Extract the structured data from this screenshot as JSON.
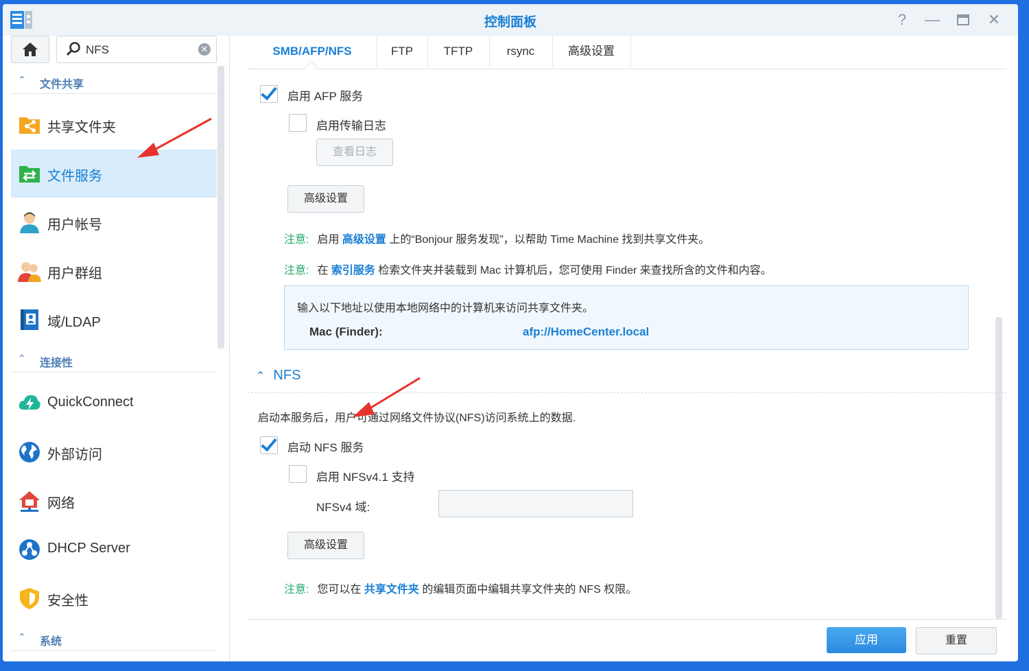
{
  "window": {
    "title": "控制面板"
  },
  "sidebar": {
    "search_value": "NFS",
    "sections": [
      {
        "label": "文件共享"
      },
      {
        "label": "连接性"
      },
      {
        "label": "系统"
      }
    ],
    "items": [
      {
        "label": "共享文件夹",
        "icon": "shared-folder-icon"
      },
      {
        "label": "文件服务",
        "icon": "file-services-icon"
      },
      {
        "label": "用户帐号",
        "icon": "user-icon"
      },
      {
        "label": "用户群组",
        "icon": "user-group-icon"
      },
      {
        "label": "域/LDAP",
        "icon": "ldap-icon"
      },
      {
        "label": "QuickConnect",
        "icon": "quickconnect-icon"
      },
      {
        "label": "外部访问",
        "icon": "globe-icon"
      },
      {
        "label": "网络",
        "icon": "network-icon"
      },
      {
        "label": "DHCP Server",
        "icon": "dhcp-icon"
      },
      {
        "label": "安全性",
        "icon": "shield-icon"
      }
    ]
  },
  "tabs": [
    {
      "label": "SMB/AFP/NFS"
    },
    {
      "label": "FTP"
    },
    {
      "label": "TFTP"
    },
    {
      "label": "rsync"
    },
    {
      "label": "高级设置"
    }
  ],
  "afp": {
    "enable_label": "启用 AFP 服务",
    "enable_checked": true,
    "log_label": "启用传输日志",
    "log_checked": false,
    "view_log_button": "查看日志",
    "advanced_button": "高级设置",
    "note1": {
      "prefix": "注意:",
      "text1": "启用",
      "link": "高级设置",
      "text2": "上的“Bonjour 服务发现”，以帮助 Time Machine 找到共享文件夹。"
    },
    "note2": {
      "prefix": "注意:",
      "text1": "在",
      "link": "索引服务",
      "text2": "检索文件夹并装载到 Mac 计算机后，您可使用 Finder 来查找所含的文件和内容。"
    },
    "info_text": "输入以下地址以使用本地网络中的计算机来访问共享文件夹。",
    "mac_label": "Mac (Finder):",
    "mac_address": "afp://HomeCenter.local"
  },
  "nfs": {
    "section_title": "NFS",
    "description": "启动本服务后，用户可通过网络文件协议(NFS)访问系统上的数据.",
    "enable_label": "启动 NFS 服务",
    "enable_checked": true,
    "v41_label": "启用 NFSv4.1 支持",
    "v41_checked": false,
    "domain_label": "NFSv4 域:",
    "domain_value": "",
    "advanced_button": "高级设置",
    "note": {
      "prefix": "注意:",
      "text1": "您可以在",
      "link": "共享文件夹",
      "text2": "的编辑页面中编辑共享文件夹的 NFS 权限。"
    }
  },
  "footer": {
    "apply": "应用",
    "reset": "重置"
  },
  "colors": {
    "accent": "#1a7fd4",
    "note_prefix": "#27a96b",
    "annotation_arrow": "#e8312a"
  }
}
